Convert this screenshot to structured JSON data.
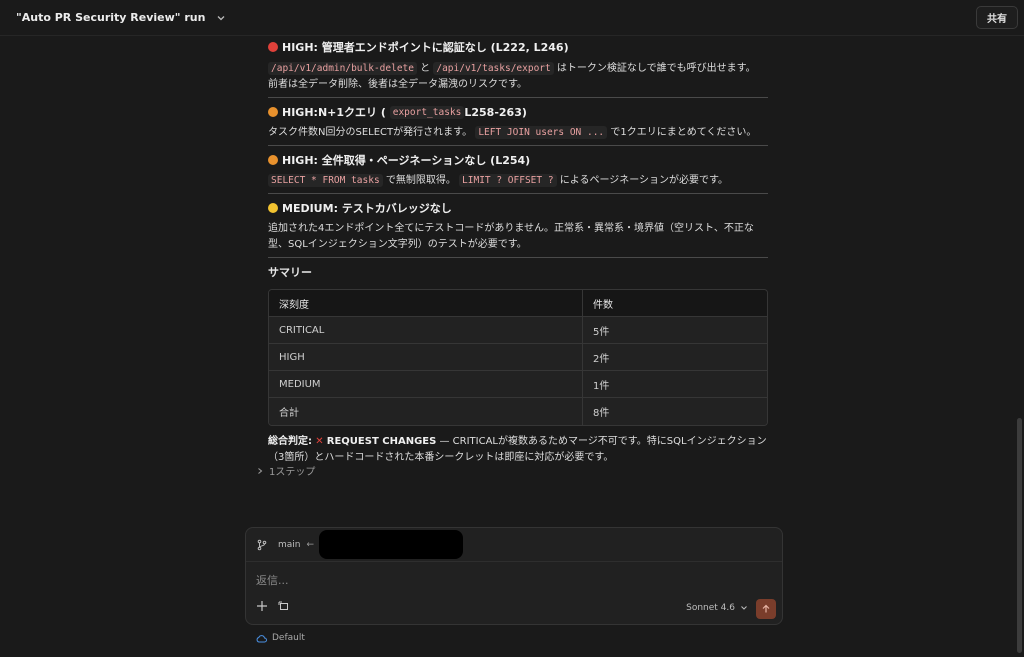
{
  "header": {
    "title": "\"Auto PR Security Review\" run",
    "share_label": "共有"
  },
  "sections": [
    {
      "severity_label": "HIGH:",
      "title": "管理者エンドポイントに認証なし (L222, L246)",
      "body_code_1": "/api/v1/admin/bulk-delete",
      "body_text_1": " と ",
      "body_code_2": "/api/v1/tasks/export",
      "body_text_2": " はトークン検証なしで誰でも呼び出せます。",
      "body_text_3": "前者は全データ削除、後者は全データ漏洩のリスクです。"
    },
    {
      "severity_label": "HIGH:",
      "title_pre": " N+1クエリ (",
      "title_code": "export_tasks",
      "title_post": " L258-263)",
      "body_text_1": "タスク件数N回分のSELECTが発行されます。",
      "body_code_1": "LEFT JOIN users ON ...",
      "body_text_2": " で1クエリにまとめてください。"
    },
    {
      "severity_label": "HIGH:",
      "title": "全件取得・ページネーションなし (L254)",
      "body_code_1": "SELECT * FROM tasks",
      "body_text_1": " で無制限取得。",
      "body_code_2": "LIMIT ? OFFSET ?",
      "body_text_2": " によるページネーションが必要です。"
    },
    {
      "severity_label": "MEDIUM:",
      "title": "テストカバレッジなし",
      "body_text_1": "追加された4エンドポイント全てにテストコードがありません。正常系・異常系・境界値（空リスト、不正な型、SQLインジェクション文字列）のテストが必要です。"
    }
  ],
  "summary": {
    "title": "サマリー",
    "columns": [
      "深刻度",
      "件数"
    ],
    "rows": [
      [
        "CRITICAL",
        "5件"
      ],
      [
        "HIGH",
        "2件"
      ],
      [
        "MEDIUM",
        "1件"
      ],
      [
        "合計",
        "8件"
      ]
    ]
  },
  "verdict": {
    "label": "総合判定:",
    "decision": "REQUEST CHANGES",
    "text": " — CRITICALが複数あるためマージ不可です。特にSQLインジェクション（3箇所）とハードコードされた本番シークレットは即座に対応が必要です。"
  },
  "steps_label": "1ステップ",
  "composer": {
    "branch": "main",
    "placeholder": "返信...",
    "model": "Sonnet 4.6"
  },
  "footer": {
    "environment": "Default"
  },
  "colors": {
    "accent_send": "#7a3d2b",
    "critical": "#e0413a",
    "high": "#e8912d",
    "medium": "#f2c330"
  }
}
